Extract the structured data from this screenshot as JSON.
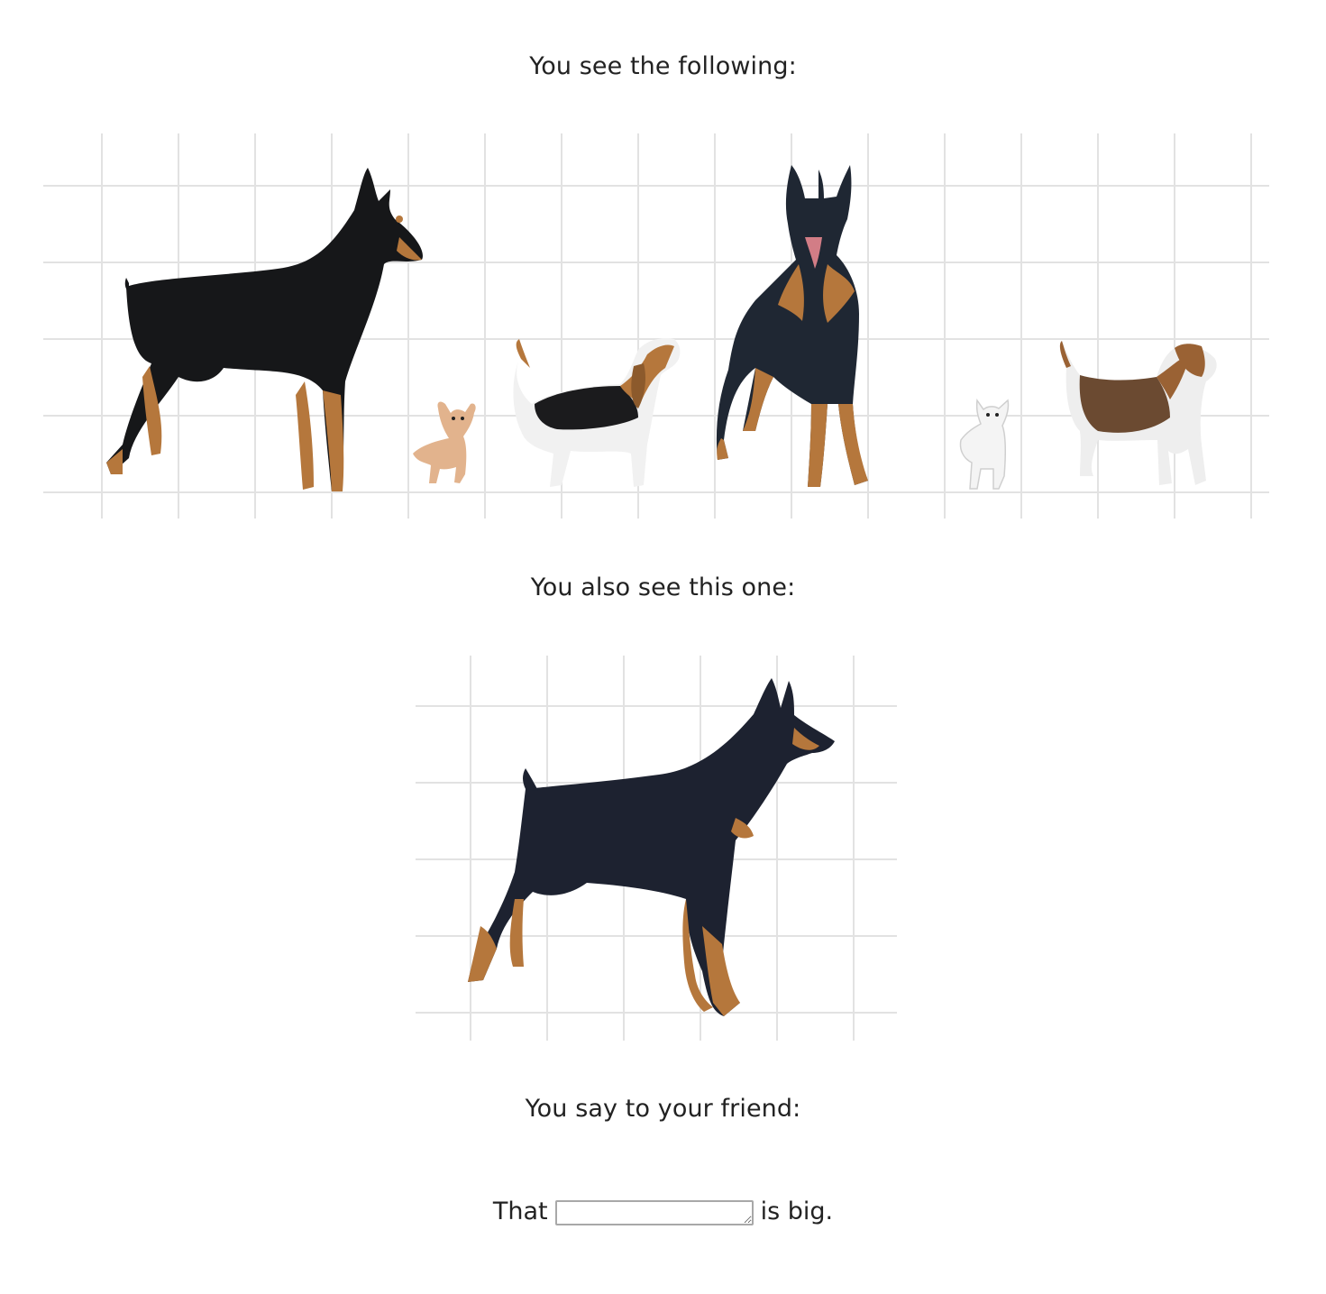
{
  "prompts": {
    "first": "You see the following:",
    "second": "You also see this one:",
    "third": "You say to your friend:"
  },
  "answer": {
    "prefix": "That",
    "value": "",
    "suffix": "is big."
  },
  "lineup": {
    "dogs": [
      {
        "breed": "doberman-side"
      },
      {
        "breed": "chihuahua-tan"
      },
      {
        "breed": "beagle-looking-up"
      },
      {
        "breed": "doberman-front"
      },
      {
        "breed": "chihuahua-white"
      },
      {
        "breed": "beagle-side"
      }
    ]
  },
  "target": {
    "dog": {
      "breed": "doberman-side"
    }
  },
  "colors": {
    "doberman_black": "#161719",
    "doberman_blue_black": "#1f2733",
    "tan": "#b5773c",
    "beagle_brown": "#9a6234",
    "white": "#f4f4f4",
    "grid": "#e2e2e2"
  }
}
